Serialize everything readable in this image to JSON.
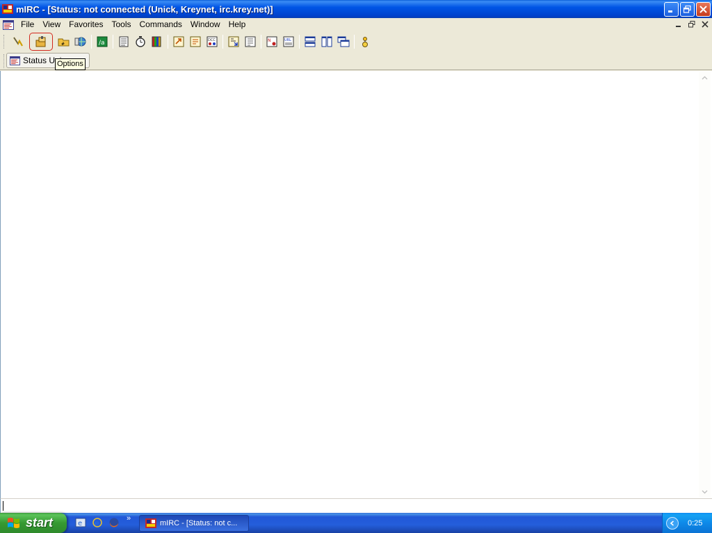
{
  "window": {
    "title": "mIRC - [Status: not connected (Unick, Kreynet, irc.krey.net)]",
    "controls": [
      "minimize",
      "restore",
      "close"
    ]
  },
  "menubar": {
    "items": [
      "File",
      "View",
      "Favorites",
      "Tools",
      "Commands",
      "Window",
      "Help"
    ],
    "mdi_controls": [
      "minimize",
      "restore",
      "close"
    ]
  },
  "toolbar": {
    "buttons": [
      {
        "icon": "connect-icon"
      },
      {
        "icon": "options-icon",
        "active": true
      },
      {
        "icon": "channel-folder-icon"
      },
      {
        "icon": "server-list-icon"
      },
      {
        "icon": "scripts-editor-icon"
      },
      {
        "icon": "address-book-icon"
      },
      {
        "icon": "timer-icon"
      },
      {
        "icon": "colors-icon"
      },
      {
        "icon": "send-file-icon"
      },
      {
        "icon": "chat-icon"
      },
      {
        "icon": "dcc-icon"
      },
      {
        "icon": "received-folder-icon"
      },
      {
        "icon": "log-folder-icon"
      },
      {
        "icon": "notify-icon"
      },
      {
        "icon": "url-list-icon"
      },
      {
        "icon": "tile-horizontal-icon"
      },
      {
        "icon": "tile-vertical-icon"
      },
      {
        "icon": "cascade-icon"
      },
      {
        "icon": "about-icon"
      }
    ]
  },
  "switchbar": {
    "tab_label": "Status Uni",
    "tooltip": "Options"
  },
  "taskbar": {
    "start_label": "start",
    "quick_launch_more": "»",
    "task_label": "mIRC - [Status: not c...",
    "clock": "0:25"
  }
}
